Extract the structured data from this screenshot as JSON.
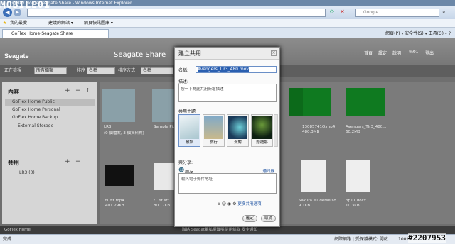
{
  "browser": {
    "window_title": "GoFlex Home Seagate Share - Windows Internet Explorer",
    "search_placeholder": "Google",
    "favorites_label": "我的最愛",
    "fav_links": [
      "建議的網站 ▾",
      "網頁快訊圖庫 ▾"
    ],
    "tab_title": "GoFlex Home-Seagate Share",
    "commands": "網頁(P) ▾  安全性(S) ▾  工具(O) ▾  ?",
    "status_left": "完成",
    "status_right": "網際網路 | 受保護模式: 開啟",
    "zoom": "100%"
  },
  "app": {
    "logo": "Seagate",
    "title": "Seagate Share",
    "top_nav": [
      "首頁",
      "設定",
      "說明",
      "m01",
      "登出"
    ],
    "toolbar": {
      "show_label": "正在檢視",
      "view_value": "所有檔案",
      "sort_label": "排序",
      "sort_value": "名稱",
      "sort_mode_label": "排序方式",
      "sort_mode_value": "名稱"
    },
    "sidebar": {
      "content_heading": "內容",
      "items": [
        "GoFlex Home Public",
        "GoFlex Home Personal",
        "GoFlex Home Backup",
        "External Storage"
      ],
      "shares_heading": "共用",
      "shares_items": [
        "LR3 (0)"
      ]
    },
    "files": [
      {
        "name": "LR3",
        "meta": "(0 個檔案, 3 個資料夾)"
      },
      {
        "name": "Sample Pictures",
        "meta": ""
      },
      {
        "name": "",
        "meta": ""
      },
      {
        "name": "",
        "meta": ""
      },
      {
        "name": "13085741O.mp4",
        "meta": "480.3MB"
      },
      {
        "name": "Avengers_Tlr3_480...",
        "meta": "60.2MB"
      },
      {
        "name": "f1.flt.mp4",
        "meta": "401.29KB"
      },
      {
        "name": "f1.flt.srt",
        "meta": "80.17KB"
      },
      {
        "name": "",
        "meta": ""
      },
      {
        "name": "",
        "meta": ""
      },
      {
        "name": "Sakura.eu.derse.so...",
        "meta": "9.1KB"
      },
      {
        "name": "np11.docx",
        "meta": "10.3KB"
      }
    ],
    "footer_items": [
      "GoFlex Home",
      "隱私權聲明",
      "使用條款",
      "安全通知",
      "聯絡 Seagate"
    ]
  },
  "dialog": {
    "title": "建立共用",
    "name_label": "名稱:",
    "name_value": "Avengers_Tlr3_480.mov",
    "desc_label": "描述:",
    "desc_value": "按一下為此共用新增描述",
    "theme_label": "共用主題",
    "themes": [
      "預設",
      "旅行",
      "派對",
      "婚禮那"
    ],
    "share_with_label": "與分享:",
    "friends_label": "朋友",
    "address_book_link": "通訊錄",
    "email_placeholder": "輸入電子郵件地址",
    "more_options": "更多共用選項",
    "buttons": [
      "確定",
      "取消"
    ]
  },
  "watermark": {
    "site": "MOBILE01",
    "id": "#2207953"
  }
}
